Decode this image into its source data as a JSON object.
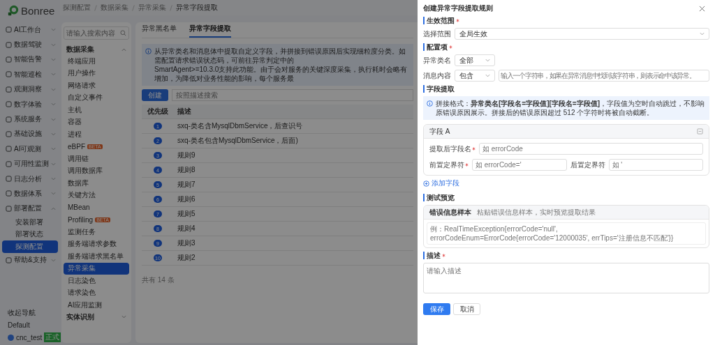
{
  "logo": {
    "text": "Bonree"
  },
  "nav": {
    "items": [
      {
        "label": "AI工作台",
        "selected": false,
        "expanded": false
      },
      {
        "label": "数据驾驶",
        "selected": false,
        "expanded": false
      },
      {
        "label": "智能告警",
        "selected": false,
        "expanded": false
      },
      {
        "label": "智能巡检",
        "selected": false,
        "expanded": false
      },
      {
        "label": "观测洞察",
        "selected": false,
        "expanded": false
      },
      {
        "label": "数字体验",
        "selected": false,
        "expanded": false
      },
      {
        "label": "系统服务",
        "selected": false,
        "expanded": false
      },
      {
        "label": "基础设施",
        "selected": false,
        "expanded": false
      },
      {
        "label": "AI可观测",
        "selected": false,
        "expanded": false
      },
      {
        "label": "可用性监测",
        "selected": false,
        "expanded": false
      },
      {
        "label": "日志分析",
        "selected": false,
        "expanded": false
      },
      {
        "label": "数据体系",
        "selected": false,
        "expanded": false
      },
      {
        "label": "部署配置",
        "selected": false,
        "expanded": true,
        "children": [
          {
            "label": "安装部署",
            "selected": false
          },
          {
            "label": "部署状态",
            "selected": false
          },
          {
            "label": "探测配置",
            "selected": true
          }
        ]
      },
      {
        "label": "帮助&支持",
        "selected": false,
        "expanded": false
      }
    ],
    "collapse": "收起导航",
    "workspace": "Default",
    "user": "cnc_test",
    "user_badge": "正式"
  },
  "breadcrumb": [
    "探测配置",
    "数据采集",
    "异常采集",
    "异常字段提取"
  ],
  "subnav": {
    "search_placeholder": "请输入搜索内容",
    "groups": [
      {
        "label": "数据采集",
        "expanded": true,
        "items": [
          {
            "label": "终端应用",
            "selected": false
          },
          {
            "label": "用户操作",
            "selected": false
          },
          {
            "label": "网络请求",
            "selected": false
          },
          {
            "label": "自定义事件",
            "selected": false
          },
          {
            "label": "主机",
            "selected": false
          },
          {
            "label": "容器",
            "selected": false
          },
          {
            "label": "进程",
            "selected": false
          },
          {
            "label": "eBPF",
            "badge": "BETA",
            "selected": false
          },
          {
            "label": "调用链",
            "selected": false
          },
          {
            "label": "调用数据库",
            "selected": false
          },
          {
            "label": "数据库",
            "selected": false
          },
          {
            "label": "关键方法",
            "selected": false
          },
          {
            "label": "MBean",
            "selected": false
          },
          {
            "label": "Profiling",
            "badge": "BETA",
            "selected": false
          },
          {
            "label": "监测任务",
            "selected": false
          },
          {
            "label": "服务端请求参数",
            "selected": false
          },
          {
            "label": "服务端请求黑名单",
            "selected": false
          },
          {
            "label": "异常采集",
            "selected": true
          },
          {
            "label": "日志染色",
            "selected": false
          },
          {
            "label": "请求染色",
            "selected": false
          },
          {
            "label": "AI应用监测",
            "selected": false
          }
        ]
      },
      {
        "label": "实体识别",
        "expanded": false
      }
    ]
  },
  "tabs": [
    {
      "label": "异常黑名单",
      "selected": false
    },
    {
      "label": "异常字段提取",
      "selected": true
    }
  ],
  "notice": [
    "从异常类名和消息体中提取自定义字段，并拼接到错误原因后实现细粒度分类。如需配置请求错误状态码，可前往异常判定中的",
    "SmartAgent>=10.3.0支持此功能。由于会对服务的关键深度采集，执行耗时会略有增加，为降低对业务性能的影响，每个服务最"
  ],
  "create_button": "创建",
  "search_placeholder": "按照描述搜索",
  "table": {
    "columns": [
      "优先级",
      "描述"
    ],
    "rows": [
      [
        "1",
        "sxq-类名含MysqlDbmService，后查识号"
      ],
      [
        "2",
        "sxq-类名包含MysqlDbmService，后面)"
      ],
      [
        "3",
        "规则9"
      ],
      [
        "4",
        "规则8"
      ],
      [
        "5",
        "规则7"
      ],
      [
        "6",
        "规则6"
      ],
      [
        "7",
        "规则5"
      ],
      [
        "8",
        "规则4"
      ],
      [
        "9",
        "规则3"
      ],
      [
        "10",
        "规则2"
      ]
    ]
  },
  "total": "共有 14 条",
  "drawer": {
    "title": "创建异常字段提取规则",
    "scope": {
      "title": "生效范围",
      "required": true,
      "label": "选择范围",
      "value": "全局生效"
    },
    "config": {
      "title": "配置项",
      "required": true,
      "class_label": "异常类名",
      "class_value": "全部",
      "msg_label": "消息内容",
      "msg_op": "包含",
      "msg_placeholder": "输入一个字符串，如果在异常消息中找到该字符串，则表示命中该异常。"
    },
    "extract": {
      "title": "字段提取",
      "required": false,
      "notice": "拼接格式：**异常类名[字段名=字段值][字段名=字段值]**，字段值为空时自动跳过，不影响原错误原因展示。拼接后的错误原因超过 512 个字符时将被自动截断。",
      "fields": [
        {
          "title": "字段 A",
          "name_label": "提取后字段名",
          "name_placeholder": "如 errorCode",
          "prefix_label": "前置定界符",
          "prefix_placeholder": "如 errorCode='",
          "suffix_label": "后置定界符",
          "suffix_placeholder": "如 '",
          "name_required": true,
          "prefix_required": true,
          "suffix_required": false
        }
      ],
      "add": "添加字段"
    },
    "preview": {
      "title": "测试预览",
      "required": false,
      "header": "错误信息样本",
      "hint": "粘贴错误信息样本，实时预览提取结果",
      "placeholder": "例：RealTimeException{errorCode='null', errorCodeEnum=ErrorCode{errorCode='12000035', errTips='注册信息不匹配'}}"
    },
    "desc": {
      "title": "描述",
      "required": true,
      "placeholder": "请输入描述"
    },
    "buttons": [
      {
        "label": "保存",
        "kind": "primary"
      },
      {
        "label": "取消",
        "kind": "default"
      }
    ]
  }
}
